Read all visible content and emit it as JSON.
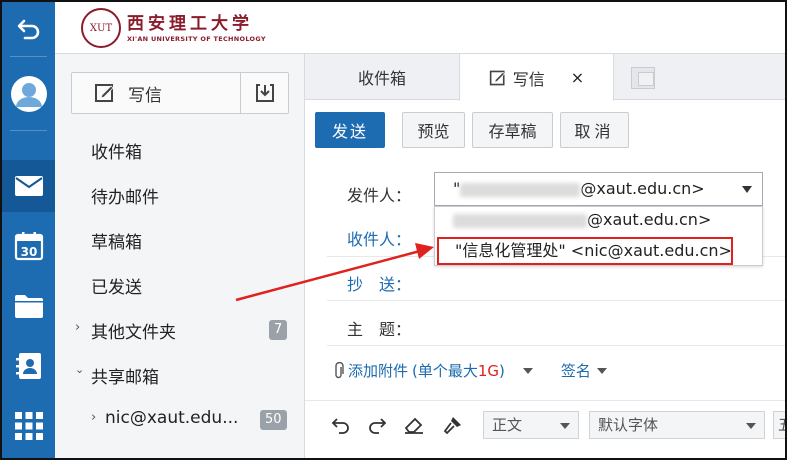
{
  "logo": {
    "chinese_name": "西安理工大学",
    "english_name": "XI'AN UNIVERSITY OF TECHNOLOGY",
    "seal_text": "XUT"
  },
  "rail": {
    "items": [
      {
        "name": "back",
        "icon": "back-arrow-icon"
      },
      {
        "name": "profile",
        "icon": "avatar-icon"
      },
      {
        "name": "mail",
        "icon": "envelope-icon",
        "active": true
      },
      {
        "name": "calendar",
        "icon": "calendar-icon",
        "day": "30"
      },
      {
        "name": "files",
        "icon": "folder-icon"
      },
      {
        "name": "contacts",
        "icon": "contacts-icon"
      },
      {
        "name": "apps",
        "icon": "grid-icon"
      }
    ]
  },
  "folders": {
    "compose_label": "写信",
    "items": [
      {
        "label": "收件箱"
      },
      {
        "label": "待办邮件"
      },
      {
        "label": "草稿箱"
      },
      {
        "label": "已发送"
      },
      {
        "label": "其他文件夹",
        "badge": "7"
      },
      {
        "label": "共享邮箱"
      },
      {
        "label": "nic@xaut.edu...",
        "badge": "50"
      }
    ]
  },
  "tabs": {
    "inbox": "收件箱",
    "write": "写信",
    "close": "×"
  },
  "toolbar": {
    "send": "发送",
    "preview": "预览",
    "save_draft": "存草稿",
    "cancel": "取消"
  },
  "form": {
    "from_label": "发件人：",
    "to_label": "收件人：",
    "cc_label": "抄　送：",
    "subject_label": "主　题：",
    "from_value_prefix": "\"",
    "from_value_suffix": "@xaut.edu.cn>",
    "dropdown_option_1_suffix": "@xaut.edu.cn>",
    "dropdown_option_2": "\"信息化管理处\" <nic@xaut.edu.cn>"
  },
  "attach": {
    "label": "添加附件",
    "limit_prefix": "(单个最大 ",
    "limit_value": "1G",
    "limit_suffix": ")",
    "signature": "签名"
  },
  "editor": {
    "paragraph_style": "正文",
    "font": "默认字体",
    "size_partial": "五"
  },
  "colors": {
    "brand_blue": "#1d6bb0",
    "highlight_red": "#e0221f",
    "school_red": "#8a1c2b"
  }
}
